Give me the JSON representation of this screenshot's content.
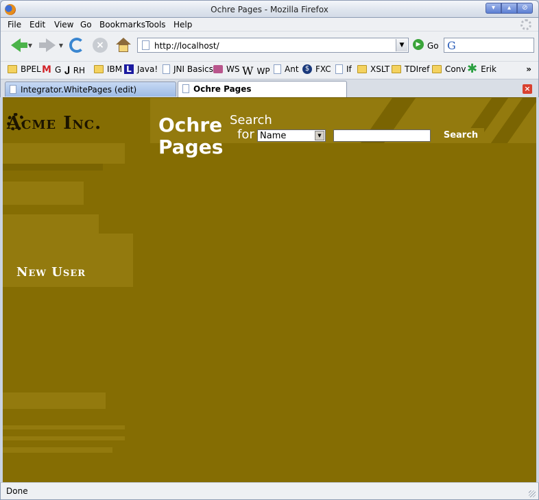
{
  "window": {
    "title": "Ochre Pages - Mozilla Firefox",
    "controls": [
      "▾",
      "▴",
      "⊘"
    ]
  },
  "menu": [
    "File",
    "Edit",
    "View",
    "Go",
    "Bookmarks",
    "Tools",
    "Help"
  ],
  "toolbar": {
    "url": "http://localhost/",
    "go_label": "Go"
  },
  "bookmarks": [
    "BPEL",
    "G",
    "RH",
    "IBM",
    "Java!",
    "JNI Basics",
    "WS",
    "WP",
    "Ant",
    "FXC",
    "If",
    "XSLT",
    "TDIref",
    "Conv",
    "Erik"
  ],
  "bookmarks_overflow": "»",
  "tabs": [
    {
      "label": "Integrator.WhitePages (edit)",
      "active": false
    },
    {
      "label": "Ochre Pages",
      "active": true
    }
  ],
  "page": {
    "logo_text": "Acme Inc.",
    "title": "Ochre Pages",
    "search_label_1": "Search",
    "search_label_2": "for",
    "search_field_value": "Name",
    "search_input_value": "",
    "search_button": "Search",
    "new_user_link": "New User"
  },
  "status": {
    "text": "Done"
  },
  "colors": {
    "content_bg": "#856d03",
    "accent": "#937a0e",
    "text": "#ffffff"
  }
}
